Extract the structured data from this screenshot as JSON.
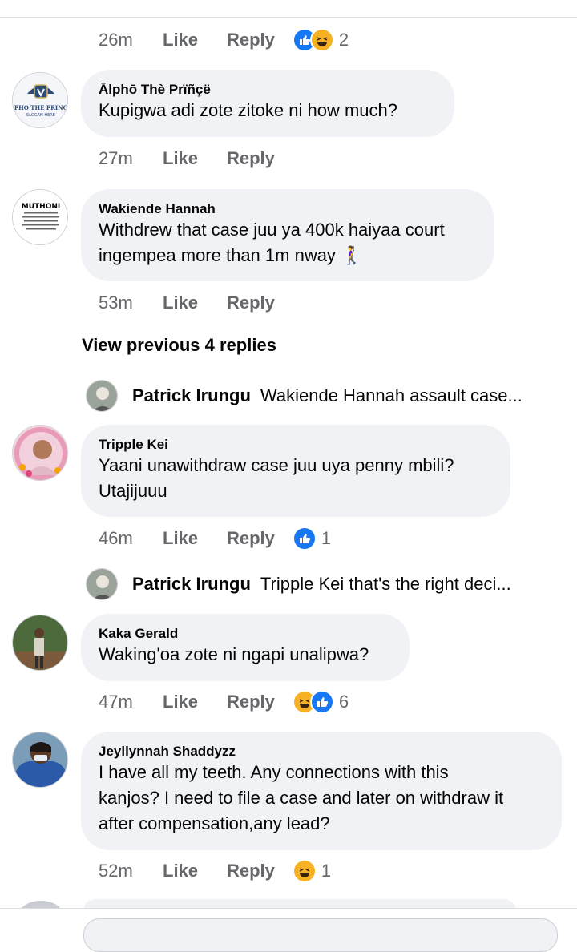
{
  "colors": {
    "bubble": "#f0f2f5",
    "meta": "#65676b",
    "like_blue": "#1877f2",
    "haha_yellow": "#f7b125"
  },
  "actions": {
    "like": "Like",
    "reply": "Reply"
  },
  "first_meta": {
    "time": "26m",
    "reactions": [
      "like",
      "haha"
    ],
    "count": "2"
  },
  "comments": [
    {
      "author": "Ālphō Thè Prïñçë",
      "text": "Kupigwa adi zote zitoke ni how much?",
      "time": "27m",
      "avatar_text": "PHO THE PRINC",
      "avatar_sub": "SLOGAN HERE"
    },
    {
      "author": "Wakiende Hannah",
      "text": "Withdrew that case juu ya 400k haiyaa court\ningempea more than 1m nway 🚶‍♀️",
      "time": "53m",
      "avatar_text": "MUTHONI"
    },
    {
      "author": "Tripple Kei",
      "text": "Yaani unawithdraw case juu uya penny mbili?\nUtajijuuu",
      "time": "46m",
      "reactions": [
        "like"
      ],
      "count": "1"
    },
    {
      "author": "Kaka Gerald",
      "text": "Waking'oa zote ni ngapi unalipwa?",
      "time": "47m",
      "reactions": [
        "haha",
        "like"
      ],
      "count": "6"
    },
    {
      "author": "Jeyllynnah Shaddyzz",
      "text": "I have all my teeth. Any connections with this\nkanjos? I need to file a case and later on withdraw it\nafter compensation,any lead?",
      "time": "52m",
      "reactions": [
        "haha"
      ],
      "count": "1"
    }
  ],
  "view_previous": "View previous 4 replies",
  "replies": [
    {
      "author": "Patrick Irungu",
      "text": "Wakiende Hannah assault case..."
    },
    {
      "author": "Patrick Irungu",
      "text": "Tripple Kei that's the right deci..."
    }
  ]
}
